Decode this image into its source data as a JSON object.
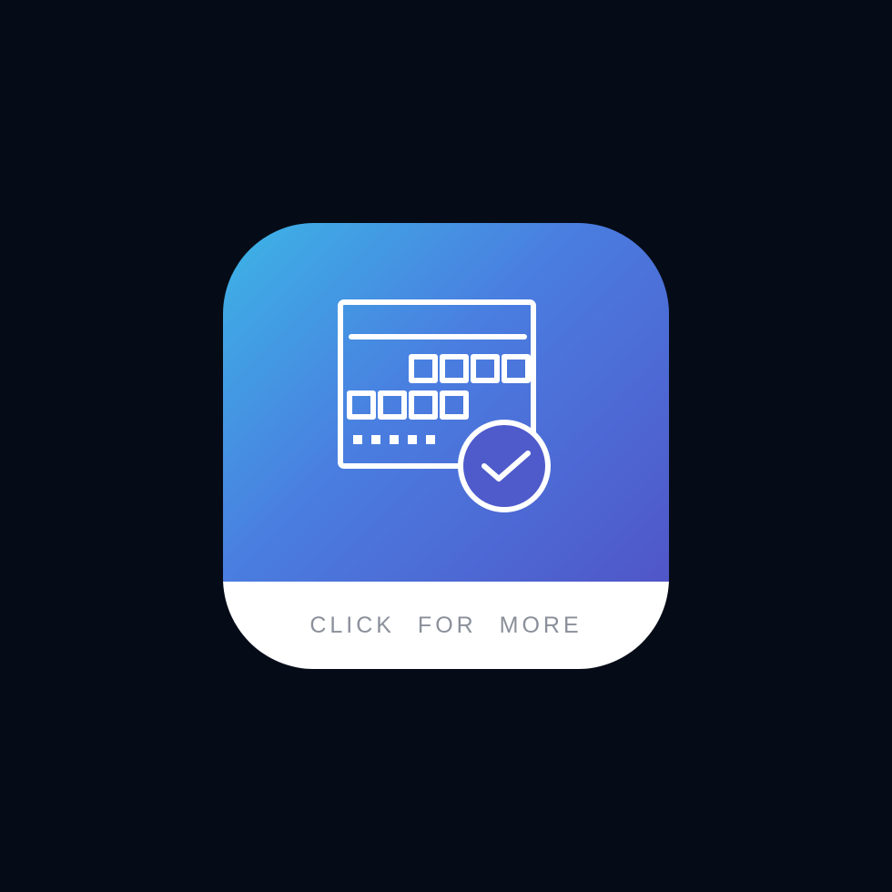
{
  "button": {
    "label": "CLICK  FOR MORE"
  },
  "colors": {
    "background": "#060c17",
    "gradient_start": "#3cb5e6",
    "gradient_mid": "#4a7de0",
    "gradient_end": "#5056c8",
    "label_bg": "#ffffff",
    "label_text": "#8a8f9a",
    "icon_stroke": "#ffffff"
  },
  "icon": {
    "name": "calendar-check-icon"
  }
}
